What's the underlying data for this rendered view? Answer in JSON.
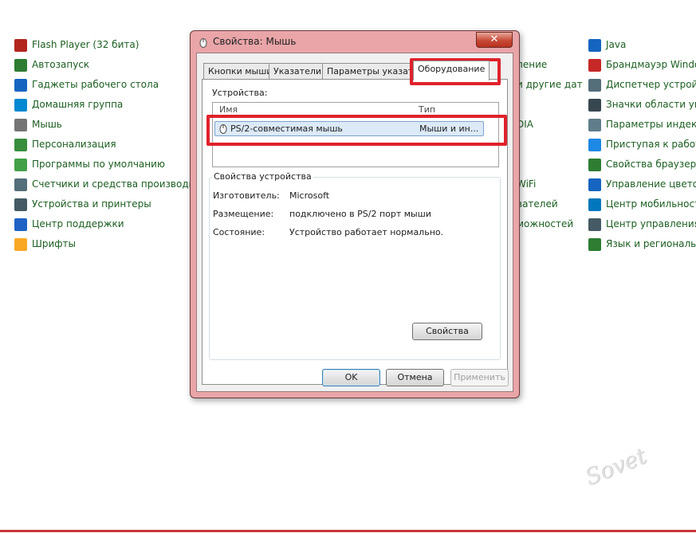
{
  "control_panel": {
    "left_items": [
      {
        "label": "Flash Player (32 бита)",
        "icon": "flash-icon",
        "color": "#b3261e"
      },
      {
        "label": "Автозапуск",
        "icon": "autoplay-icon",
        "color": "#2e7d32"
      },
      {
        "label": "Гаджеты рабочего стола",
        "icon": "gadgets-icon",
        "color": "#1565c0"
      },
      {
        "label": "Домашняя группа",
        "icon": "homegroup-icon",
        "color": "#0288d1"
      },
      {
        "label": "Мышь",
        "icon": "mouse-icon",
        "color": "#757575"
      },
      {
        "label": "Персонализация",
        "icon": "personalization-icon",
        "color": "#388e3c"
      },
      {
        "label": "Программы по умолчанию",
        "icon": "default-programs-icon",
        "color": "#43a047"
      },
      {
        "label": "Счетчики и средства производител",
        "icon": "performance-icon",
        "color": "#546e7a"
      },
      {
        "label": "Устройства и принтеры",
        "icon": "printer-icon",
        "color": "#455a64"
      },
      {
        "label": "Центр поддержки",
        "icon": "flag-icon",
        "color": "#1e63c4"
      },
      {
        "label": "Шрифты",
        "icon": "fonts-icon",
        "color": "#f9a825"
      }
    ],
    "middle_items": [
      "",
      "пение",
      "и другие дат",
      "",
      "DIA",
      "",
      "",
      "WiFi",
      "вателей",
      "можностей"
    ],
    "right_items": [
      {
        "label": "Java",
        "icon": "java-icon",
        "color": "#1565c0"
      },
      {
        "label": "Брандмауэр Windows",
        "icon": "firewall-icon",
        "color": "#c62828"
      },
      {
        "label": "Диспетчер устройств",
        "icon": "device-manager-icon",
        "color": "#546e7a"
      },
      {
        "label": "Значки области уведо",
        "icon": "tray-icons-icon",
        "color": "#37474f"
      },
      {
        "label": "Параметры индексир",
        "icon": "indexing-icon",
        "color": "#607d8b"
      },
      {
        "label": "Приступая к работе",
        "icon": "getting-started-icon",
        "color": "#1e88e5"
      },
      {
        "label": "Свойства браузера",
        "icon": "browser-icon",
        "color": "#2e7d32"
      },
      {
        "label": "Управление цветом",
        "icon": "color-management-icon",
        "color": "#1565c0"
      },
      {
        "label": "Центр мобильности",
        "icon": "mobility-icon",
        "color": "#0277bd"
      },
      {
        "label": "Центр управления сет",
        "icon": "network-icon",
        "color": "#455a64"
      },
      {
        "label": "Язык и региональны",
        "icon": "region-icon",
        "color": "#2e7d32"
      }
    ]
  },
  "dialog": {
    "title": "Свойства: Мышь",
    "close_label": "✕",
    "tabs": [
      "Кнопки мыши",
      "Указатели",
      "Параметры указателя",
      "Оборудование"
    ],
    "devices_label": "Устройства:",
    "columns": [
      "Имя",
      "Тип"
    ],
    "device": {
      "name": "PS/2-совместимая мышь",
      "type": "Мыши и ин..."
    },
    "properties_group": "Свойства устройства",
    "properties": [
      {
        "key": "Изготовитель:",
        "value": "Microsoft"
      },
      {
        "key": "Размещение:",
        "value": "подключено в PS/2 порт мыши"
      },
      {
        "key": "Состояние:",
        "value": "Устройство работает нормально."
      }
    ],
    "properties_button": "Свойства",
    "ok": "OK",
    "cancel": "Отмена",
    "apply": "Применить"
  },
  "highlight_color": "#e0212b",
  "watermark": "club Sovet"
}
